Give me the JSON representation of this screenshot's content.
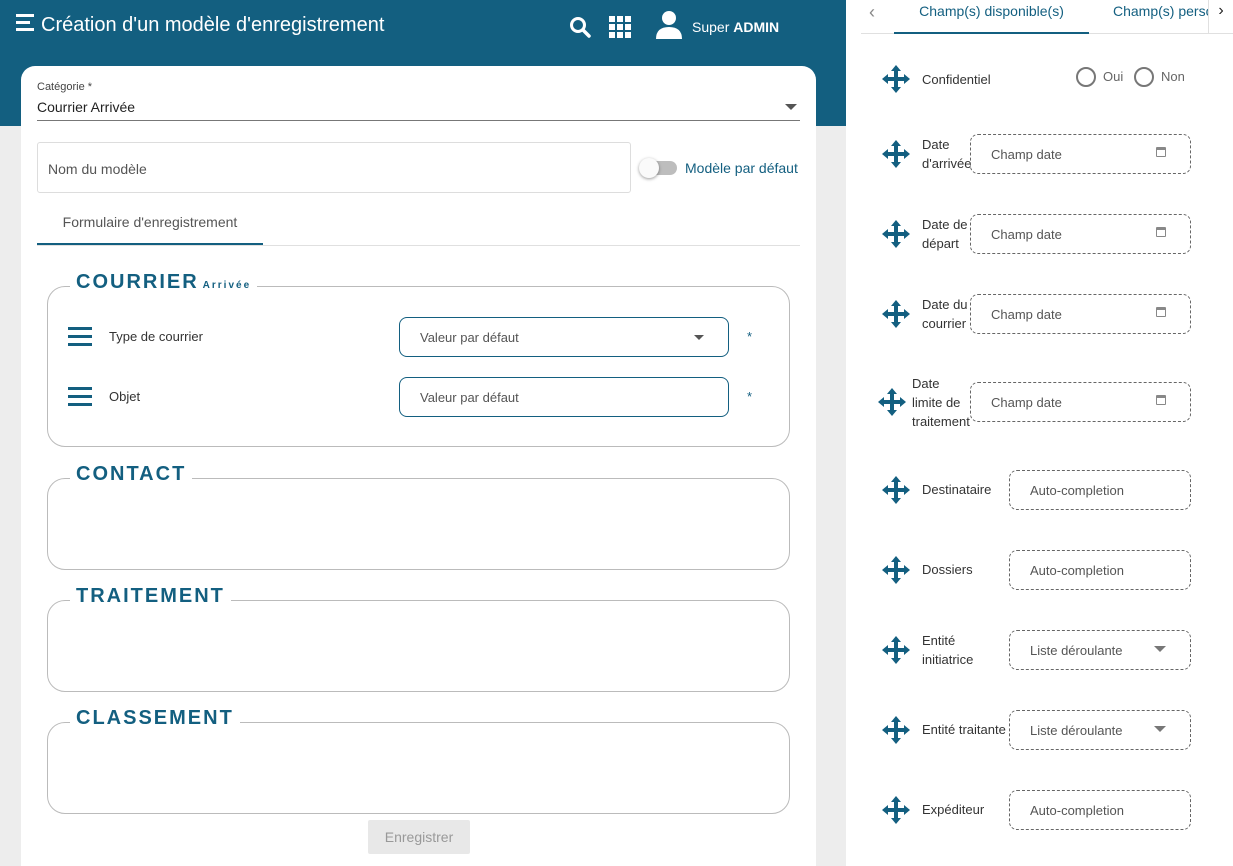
{
  "header": {
    "title": "Création d'un modèle d'enregistrement",
    "user_first": "Super",
    "user_last": "ADMIN"
  },
  "form": {
    "category_label": "Catégorie *",
    "category_value": "Courrier Arrivée",
    "name_placeholder": "Nom du modèle",
    "default_toggle_label": "Modèle par défaut",
    "default_toggle_on": false,
    "tab_label": "Formulaire d'enregistrement",
    "sections": {
      "courrier": {
        "title": "COURRIER",
        "subtitle": "Arrivée"
      },
      "contact": {
        "title": "CONTACT"
      },
      "traitement": {
        "title": "TRAITEMENT"
      },
      "classement": {
        "title": "CLASSEMENT"
      }
    },
    "fields": [
      {
        "label": "Type de courrier",
        "placeholder": "Valeur par défaut",
        "required": "*"
      },
      {
        "label": "Objet",
        "placeholder": "Valeur par défaut",
        "required": "*"
      }
    ],
    "save_label": "Enregistrer"
  },
  "panel": {
    "tab_available": "Champ(s) disponible(s)",
    "tab_custom": "Champ(s) personnalisé(s)",
    "confidential": {
      "label": "Confidentiel",
      "yes": "Oui",
      "no": "Non"
    },
    "date_fields": [
      {
        "label_lines": [
          "Date",
          "d'arrivée"
        ],
        "placeholder": "Champ date"
      },
      {
        "label_lines": [
          "Date de",
          "départ"
        ],
        "placeholder": "Champ date"
      },
      {
        "label_lines": [
          "Date du",
          "courrier"
        ],
        "placeholder": "Champ date"
      },
      {
        "label_lines": [
          "Date",
          "limite de",
          "traitement"
        ],
        "placeholder": "Champ date"
      }
    ],
    "other_fields": [
      {
        "label_lines": [
          "Destinataire"
        ],
        "placeholder": "Auto-completion",
        "kind": "autocomplete"
      },
      {
        "label_lines": [
          "Dossiers"
        ],
        "placeholder": "Auto-completion",
        "kind": "autocomplete"
      },
      {
        "label_lines": [
          "Entité",
          "initiatrice"
        ],
        "placeholder": "Liste déroulante",
        "kind": "select"
      },
      {
        "label_lines": [
          "Entité traitante"
        ],
        "placeholder": "Liste déroulante",
        "kind": "select"
      },
      {
        "label_lines": [
          "Expéditeur"
        ],
        "placeholder": "Auto-completion",
        "kind": "autocomplete"
      }
    ]
  },
  "colors": {
    "primary": "#135f80",
    "background": "#ededed"
  },
  "icons": [
    "menu-icon",
    "search-icon",
    "apps-grid-icon",
    "user-icon",
    "drag-handle-icon",
    "move-icon",
    "calendar-icon",
    "chevron-left-icon",
    "chevron-right-icon",
    "caret-down-icon"
  ]
}
